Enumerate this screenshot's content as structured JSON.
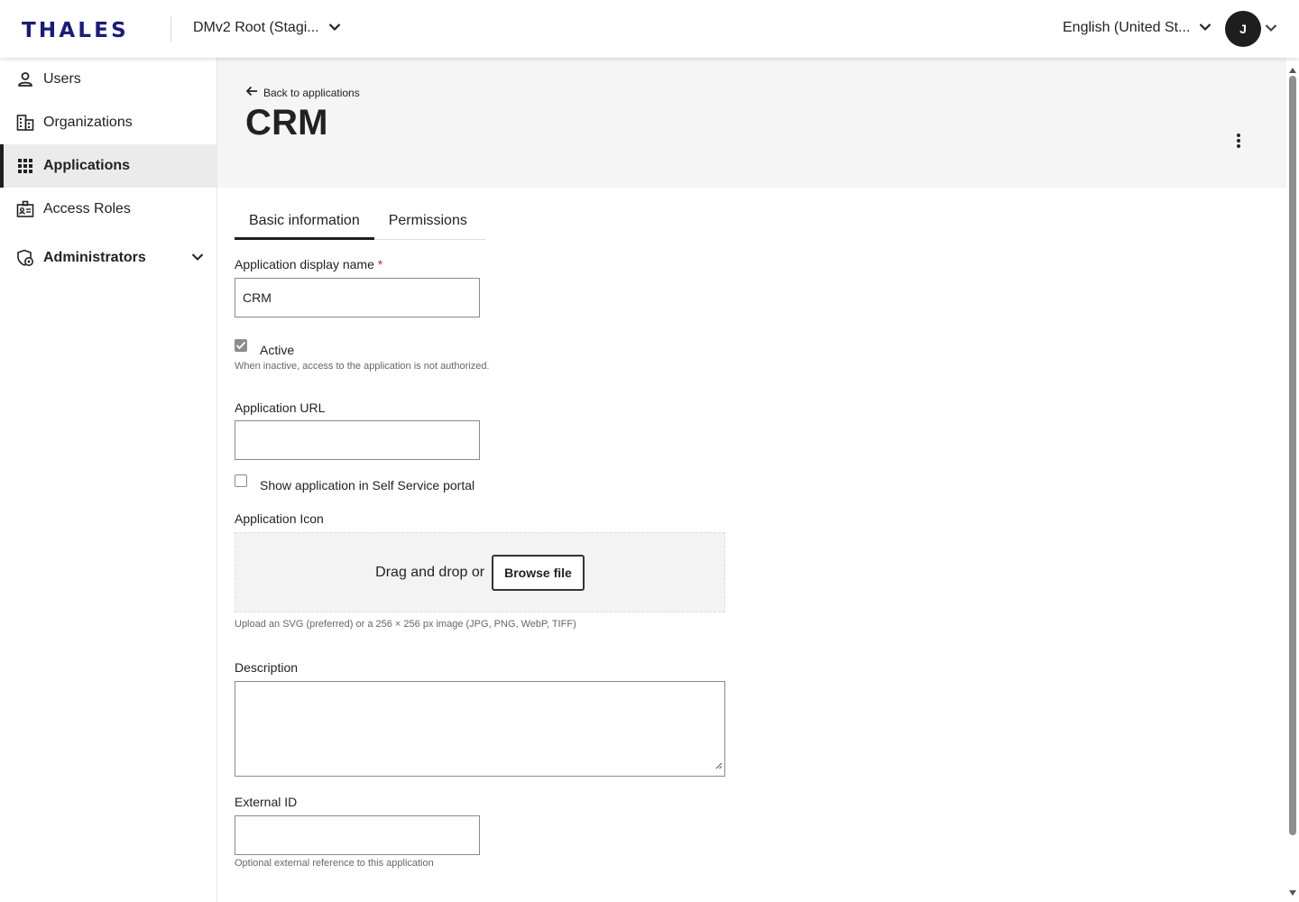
{
  "header": {
    "brand": "THALES",
    "tenant": "DMv2 Root (Stagi...",
    "language": "English (United St...",
    "avatar_initial": "J"
  },
  "sidebar": {
    "items": [
      {
        "label": "Users",
        "icon": "person-icon"
      },
      {
        "label": "Organizations",
        "icon": "building-icon"
      },
      {
        "label": "Applications",
        "icon": "apps-grid-icon",
        "active": true
      },
      {
        "label": "Access Roles",
        "icon": "badge-icon"
      },
      {
        "label": "Administrators",
        "icon": "admin-shield-icon",
        "expandable": true
      }
    ]
  },
  "page": {
    "back_label": "Back to applications",
    "title": "CRM"
  },
  "tabs": [
    {
      "label": "Basic information",
      "active": true
    },
    {
      "label": "Permissions"
    }
  ],
  "form": {
    "display_name_label": "Application display name",
    "required_mark": "*",
    "display_name_value": "CRM",
    "active_label": "Active",
    "active_checked": true,
    "active_helper": "When inactive, access to the application is not authorized.",
    "url_label": "Application URL",
    "url_value": "",
    "self_service_label": "Show application in Self Service portal",
    "self_service_checked": false,
    "icon_label": "Application Icon",
    "dropzone_text": "Drag and drop or",
    "browse_button": "Browse file",
    "icon_helper": "Upload an SVG (preferred) or a 256 × 256 px image (JPG, PNG, WebP, TIFF)",
    "description_label": "Description",
    "description_value": "",
    "external_id_label": "External ID",
    "external_id_value": "",
    "external_id_helper": "Optional external reference to this application"
  },
  "colors": {
    "brand": "#1a1b7a",
    "active_nav_bg": "#ebebeb",
    "page_header_bg": "#f5f5f5",
    "required": "#d42020"
  }
}
